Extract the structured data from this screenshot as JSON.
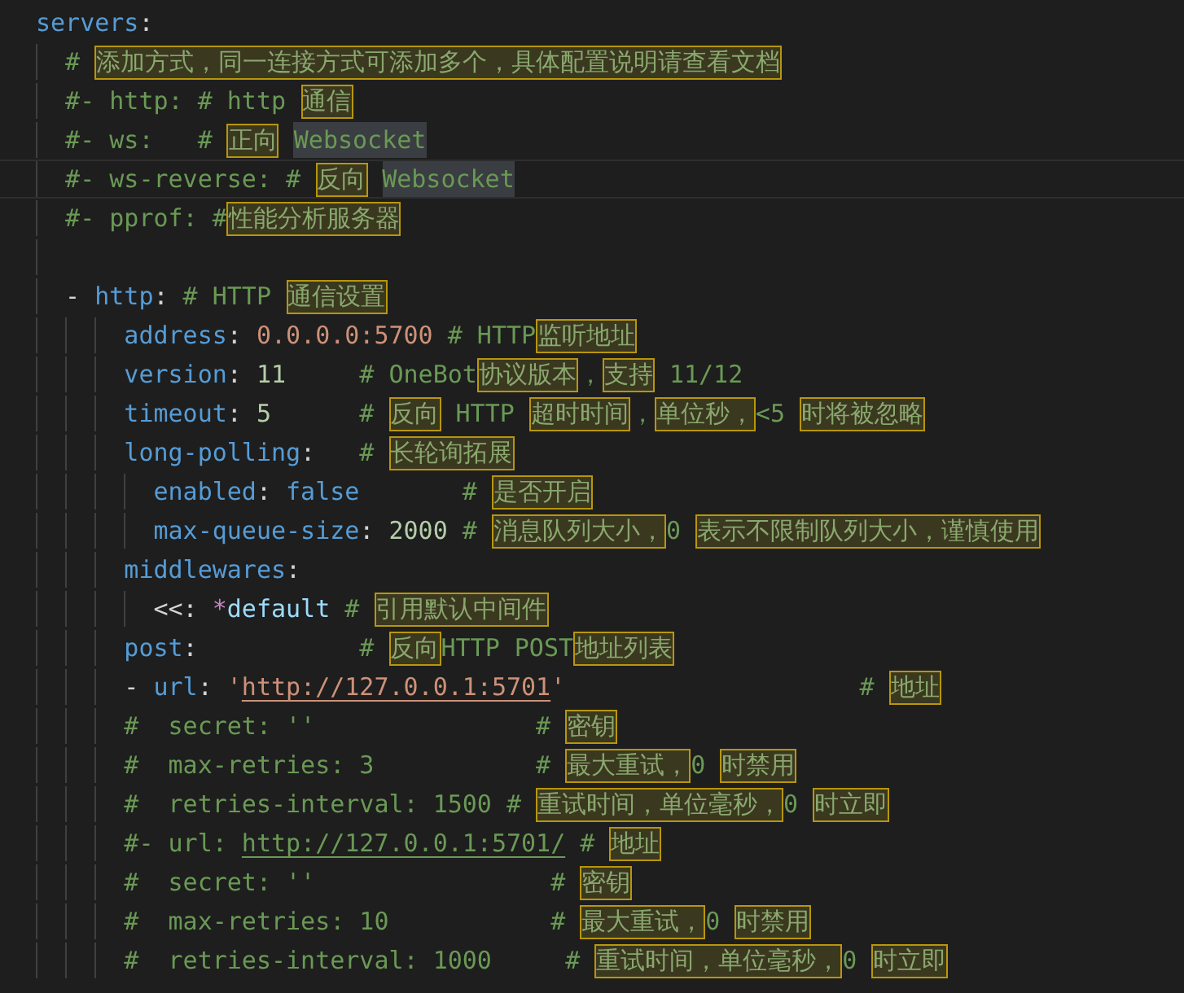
{
  "editor": {
    "lines": [
      {
        "kind": "code",
        "tokens": [
          {
            "kind": "key",
            "text": "servers"
          },
          {
            "kind": "punct",
            "text": ":"
          }
        ]
      },
      {
        "kind": "code",
        "tokens": [
          {
            "kind": "comment",
            "text": "  # "
          },
          {
            "kind": "cjk",
            "text": "添加方式，同一连接方式可添加多个，具体配置说明请查看文档"
          }
        ]
      },
      {
        "kind": "code",
        "tokens": [
          {
            "kind": "comment",
            "text": "  #- http: # http "
          },
          {
            "kind": "cjk",
            "text": "通信"
          }
        ]
      },
      {
        "kind": "code",
        "tokens": [
          {
            "kind": "comment",
            "text": "  #- ws:   # "
          },
          {
            "kind": "cjk",
            "text": "正向"
          },
          {
            "kind": "match",
            "text": "Websocket"
          }
        ]
      },
      {
        "kind": "code",
        "current": true,
        "tokens": [
          {
            "kind": "comment",
            "text": "  #- ws-reverse: # "
          },
          {
            "kind": "cjk",
            "text": "反向"
          },
          {
            "kind": "match",
            "text": "Websocket"
          }
        ]
      },
      {
        "kind": "code",
        "tokens": [
          {
            "kind": "comment",
            "text": "  #- pprof: #"
          },
          {
            "kind": "cjk",
            "text": "性能分析服务器"
          }
        ]
      },
      {
        "kind": "blank"
      },
      {
        "kind": "code",
        "tokens": [
          {
            "kind": "punct",
            "text": "  - "
          },
          {
            "kind": "key",
            "text": "http"
          },
          {
            "kind": "punct",
            "text": ": "
          },
          {
            "kind": "comment",
            "text": "# HTTP "
          },
          {
            "kind": "cjk",
            "text": "通信设置"
          }
        ]
      },
      {
        "kind": "code",
        "tokens": [
          {
            "kind": "key",
            "text": "      address"
          },
          {
            "kind": "punct",
            "text": ": "
          },
          {
            "kind": "string",
            "text": "0.0.0.0:5700"
          },
          {
            "kind": "comment",
            "text": " # HTTP"
          },
          {
            "kind": "cjk",
            "text": "监听地址"
          }
        ]
      },
      {
        "kind": "code",
        "tokens": [
          {
            "kind": "key",
            "text": "      version"
          },
          {
            "kind": "punct",
            "text": ": "
          },
          {
            "kind": "number",
            "text": "11"
          },
          {
            "kind": "comment",
            "text": "     # OneBot"
          },
          {
            "kind": "cjk",
            "text": "协议版本"
          },
          {
            "kind": "comment",
            "text": "，"
          },
          {
            "kind": "cjk",
            "text": "支持"
          },
          {
            "kind": "comment",
            "text": " 11/12"
          }
        ]
      },
      {
        "kind": "code",
        "tokens": [
          {
            "kind": "key",
            "text": "      timeout"
          },
          {
            "kind": "punct",
            "text": ": "
          },
          {
            "kind": "number",
            "text": "5"
          },
          {
            "kind": "comment",
            "text": "      # "
          },
          {
            "kind": "cjk",
            "text": "反向"
          },
          {
            "kind": "comment",
            "text": " HTTP "
          },
          {
            "kind": "cjk",
            "text": "超时时间"
          },
          {
            "kind": "comment",
            "text": "，"
          },
          {
            "kind": "cjk",
            "text": "单位秒，"
          },
          {
            "kind": "comment",
            "text": "<5 "
          },
          {
            "kind": "cjk",
            "text": "时将被忽略"
          }
        ]
      },
      {
        "kind": "code",
        "tokens": [
          {
            "kind": "key",
            "text": "      long-polling"
          },
          {
            "kind": "punct",
            "text": ":"
          },
          {
            "kind": "comment",
            "text": "   # "
          },
          {
            "kind": "cjk",
            "text": "长轮询拓展"
          }
        ]
      },
      {
        "kind": "code",
        "tokens": [
          {
            "kind": "key",
            "text": "        enabled"
          },
          {
            "kind": "punct",
            "text": ": "
          },
          {
            "kind": "keyword",
            "text": "false"
          },
          {
            "kind": "comment",
            "text": "       # "
          },
          {
            "kind": "cjk",
            "text": "是否开启"
          }
        ]
      },
      {
        "kind": "code",
        "tokens": [
          {
            "kind": "key",
            "text": "        max-queue-size"
          },
          {
            "kind": "punct",
            "text": ": "
          },
          {
            "kind": "number",
            "text": "2000"
          },
          {
            "kind": "comment",
            "text": " # "
          },
          {
            "kind": "cjk",
            "text": "消息队列大小，"
          },
          {
            "kind": "comment",
            "text": "0 "
          },
          {
            "kind": "cjk",
            "text": "表示不限制队列大小，谨慎使用"
          }
        ]
      },
      {
        "kind": "code",
        "tokens": [
          {
            "kind": "key",
            "text": "      middlewares"
          },
          {
            "kind": "punct",
            "text": ":"
          }
        ]
      },
      {
        "kind": "code",
        "tokens": [
          {
            "kind": "punct",
            "text": "        <<: "
          },
          {
            "kind": "anchor",
            "text": "*"
          },
          {
            "kind": "ref",
            "text": "default"
          },
          {
            "kind": "comment",
            "text": " # "
          },
          {
            "kind": "cjk",
            "text": "引用默认中间件"
          }
        ]
      },
      {
        "kind": "code",
        "tokens": [
          {
            "kind": "key",
            "text": "      post"
          },
          {
            "kind": "punct",
            "text": ":"
          },
          {
            "kind": "comment",
            "text": "           # "
          },
          {
            "kind": "cjk",
            "text": "反向"
          },
          {
            "kind": "comment",
            "text": "HTTP POST"
          },
          {
            "kind": "cjk",
            "text": "地址列表"
          }
        ]
      },
      {
        "kind": "code",
        "tokens": [
          {
            "kind": "punct",
            "text": "      - "
          },
          {
            "kind": "key",
            "text": "url"
          },
          {
            "kind": "punct",
            "text": ": "
          },
          {
            "kind": "string",
            "text": "'"
          },
          {
            "kind": "link",
            "text": "http://127.0.0.1:5701"
          },
          {
            "kind": "string",
            "text": "'"
          },
          {
            "kind": "comment",
            "text": "                    # "
          },
          {
            "kind": "cjk",
            "text": "地址"
          }
        ]
      },
      {
        "kind": "code",
        "tokens": [
          {
            "kind": "comment",
            "text": "      #  secret: ''               # "
          },
          {
            "kind": "cjk",
            "text": "密钥"
          }
        ]
      },
      {
        "kind": "code",
        "tokens": [
          {
            "kind": "comment",
            "text": "      #  max-retries: 3           # "
          },
          {
            "kind": "cjk",
            "text": "最大重试，"
          },
          {
            "kind": "comment",
            "text": "0 "
          },
          {
            "kind": "cjk",
            "text": "时禁用"
          }
        ]
      },
      {
        "kind": "code",
        "tokens": [
          {
            "kind": "comment",
            "text": "      #  retries-interval: 1500 # "
          },
          {
            "kind": "cjk",
            "text": "重试时间，单位毫秒，"
          },
          {
            "kind": "comment",
            "text": "0 "
          },
          {
            "kind": "cjk",
            "text": "时立即"
          }
        ]
      },
      {
        "kind": "code",
        "tokens": [
          {
            "kind": "comment",
            "text": "      #- url: "
          },
          {
            "kind": "comment-link",
            "text": "http://127.0.0.1:5701/"
          },
          {
            "kind": "comment",
            "text": " # "
          },
          {
            "kind": "cjk",
            "text": "地址"
          }
        ]
      },
      {
        "kind": "code",
        "tokens": [
          {
            "kind": "comment",
            "text": "      #  secret: ''                # "
          },
          {
            "kind": "cjk",
            "text": "密钥"
          }
        ]
      },
      {
        "kind": "code",
        "tokens": [
          {
            "kind": "comment",
            "text": "      #  max-retries: 10           # "
          },
          {
            "kind": "cjk",
            "text": "最大重试，"
          },
          {
            "kind": "comment",
            "text": "0 "
          },
          {
            "kind": "cjk",
            "text": "时禁用"
          }
        ]
      },
      {
        "kind": "code",
        "tokens": [
          {
            "kind": "comment",
            "text": "      #  retries-interval: 1000     # "
          },
          {
            "kind": "cjk",
            "text": "重试时间，单位毫秒，"
          },
          {
            "kind": "comment",
            "text": "0 "
          },
          {
            "kind": "cjk",
            "text": "时立即"
          }
        ]
      }
    ]
  }
}
